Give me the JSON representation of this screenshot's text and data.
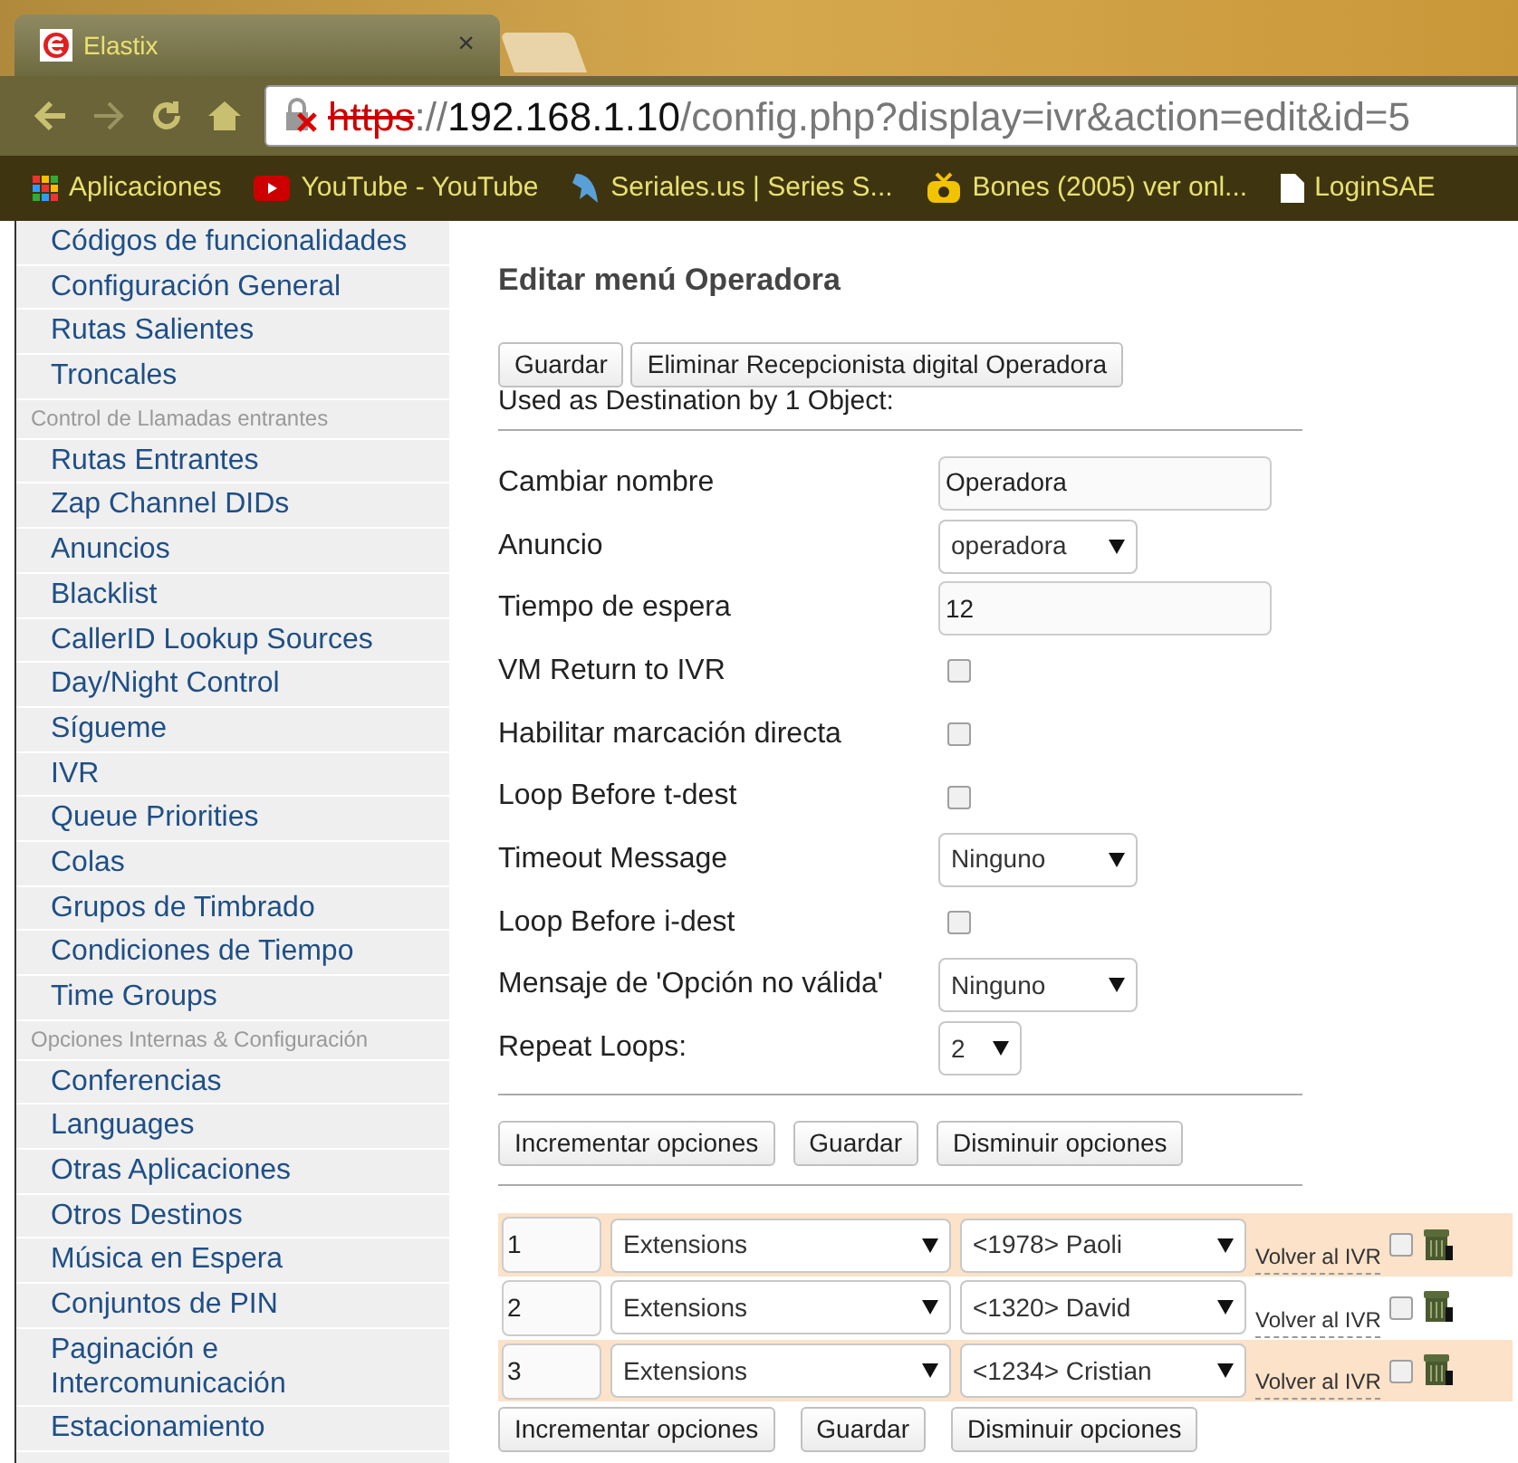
{
  "browser": {
    "tab": {
      "title": "Elastix",
      "close": "×"
    },
    "url": {
      "scheme": "https",
      "sep": "://",
      "host": "192.168.1.10",
      "path": "/config.php?display=ivr&action=edit&id=5"
    },
    "bookmarks": [
      {
        "label": "Aplicaciones",
        "kind": "apps"
      },
      {
        "label": "YouTube - YouTube",
        "kind": "youtube"
      },
      {
        "label": "Seriales.us | Series S...",
        "kind": "bird"
      },
      {
        "label": "Bones (2005) ver onl...",
        "kind": "tv"
      },
      {
        "label": "LoginSAE",
        "kind": "page"
      }
    ]
  },
  "sidebar": {
    "items": [
      {
        "label": "Códigos de funcionalidades",
        "kind": "link"
      },
      {
        "label": "Configuración General",
        "kind": "link"
      },
      {
        "label": "Rutas Salientes",
        "kind": "link"
      },
      {
        "label": "Troncales",
        "kind": "link"
      },
      {
        "label": "Control de Llamadas entrantes",
        "kind": "header"
      },
      {
        "label": "Rutas Entrantes",
        "kind": "link"
      },
      {
        "label": "Zap Channel DIDs",
        "kind": "link"
      },
      {
        "label": "Anuncios",
        "kind": "link"
      },
      {
        "label": "Blacklist",
        "kind": "link"
      },
      {
        "label": "CallerID Lookup Sources",
        "kind": "link"
      },
      {
        "label": "Day/Night Control",
        "kind": "link"
      },
      {
        "label": "Sígueme",
        "kind": "link"
      },
      {
        "label": "IVR",
        "kind": "link"
      },
      {
        "label": "Queue Priorities",
        "kind": "link"
      },
      {
        "label": "Colas",
        "kind": "link"
      },
      {
        "label": "Grupos de Timbrado",
        "kind": "link"
      },
      {
        "label": "Condiciones de Tiempo",
        "kind": "link"
      },
      {
        "label": "Time Groups",
        "kind": "link"
      },
      {
        "label": "Opciones Internas & Configuración",
        "kind": "header"
      },
      {
        "label": "Conferencias",
        "kind": "link"
      },
      {
        "label": "Languages",
        "kind": "link"
      },
      {
        "label": "Otras Aplicaciones",
        "kind": "link"
      },
      {
        "label": "Otros Destinos",
        "kind": "link"
      },
      {
        "label": "Música en Espera",
        "kind": "link"
      },
      {
        "label": "Conjuntos de PIN",
        "kind": "link"
      },
      {
        "label": "Paginación e Intercomunicación",
        "kind": "link"
      },
      {
        "label": "Estacionamiento",
        "kind": "link"
      }
    ]
  },
  "form": {
    "title": "Editar menú Operadora",
    "top_buttons": [
      "Guardar",
      "Eliminar Recepcionista digital Operadora"
    ],
    "used_as": "Used as Destination by 1 Object:",
    "fields": [
      {
        "label": "Cambiar nombre",
        "kind": "text",
        "value": "Operadora"
      },
      {
        "label": "Anuncio",
        "kind": "select",
        "value": "operadora"
      },
      {
        "label": "Tiempo de espera",
        "kind": "text",
        "value": "12"
      },
      {
        "label": "VM Return to IVR",
        "kind": "checkbox",
        "checked": false
      },
      {
        "label": "Habilitar marcación directa",
        "kind": "checkbox",
        "checked": false
      },
      {
        "label": "Loop Before t-dest",
        "kind": "checkbox",
        "checked": false
      },
      {
        "label": "Timeout Message",
        "kind": "select",
        "value": "Ninguno"
      },
      {
        "label": "Loop Before i-dest",
        "kind": "checkbox",
        "checked": false
      },
      {
        "label": "Mensaje de 'Opción no válida'",
        "kind": "select",
        "value": "Ninguno"
      },
      {
        "label": "Repeat Loops:",
        "kind": "smallselect",
        "value": "2"
      }
    ],
    "mid_buttons": [
      "Incrementar opciones",
      "Guardar",
      "Disminuir opciones"
    ],
    "options": [
      {
        "digit": "1",
        "type": "Extensions",
        "destination": "<1978> Paoli",
        "return_label": "Volver al IVR",
        "checked": false
      },
      {
        "digit": "2",
        "type": "Extensions",
        "destination": "<1320> David",
        "return_label": "Volver al IVR",
        "checked": false
      },
      {
        "digit": "3",
        "type": "Extensions",
        "destination": "<1234> Cristian",
        "return_label": "Volver al IVR",
        "checked": false
      }
    ],
    "bottom_buttons": [
      "Incrementar opciones",
      "Guardar",
      "Disminuir opciones"
    ]
  }
}
